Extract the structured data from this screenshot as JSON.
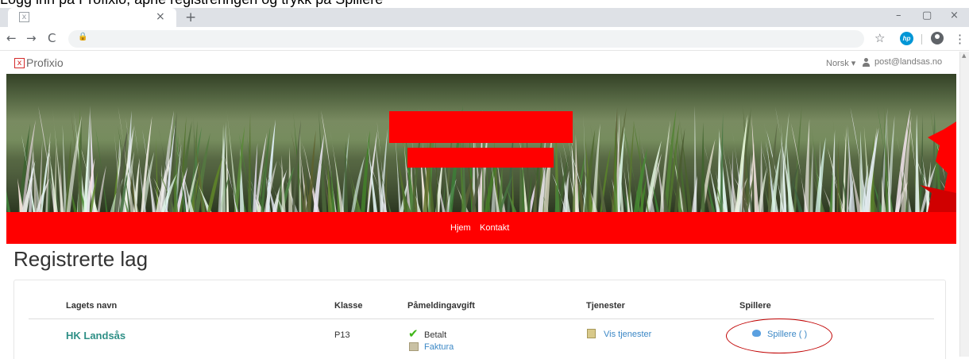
{
  "caption": "Logg inn på Profixio, åpne registreringen og trykk på Spillere",
  "browser": {
    "tab_close": "×",
    "new_tab": "+",
    "back": "←",
    "forward": "→",
    "reload": "C",
    "lock": "🔒",
    "url": "",
    "star": "☆",
    "hp": "hp",
    "kebab": "⋮",
    "minimize": "–",
    "maximize": "▢",
    "close": "×"
  },
  "site": {
    "logo_mark": "x",
    "logo_text": "Profixio",
    "language": "Norsk ▾",
    "user_email": "post@landsas.no"
  },
  "nav": {
    "home": "Hjem",
    "contact": "Kontakt"
  },
  "page_title": "Registrerte lag",
  "table": {
    "headers": {
      "team": "Lagets navn",
      "class": "Klasse",
      "fee": "Påmeldingavgift",
      "services": "Tjenester",
      "players": "Spillere"
    },
    "row": {
      "team": "HK Landsås",
      "class": "P13",
      "fee_status": "Betalt",
      "invoice": "Faktura",
      "services_link": "Vis tjenester",
      "players_link": "Spillere (   )"
    }
  },
  "colors": {
    "accent_red": "#ff0000",
    "team_teal": "#2e8f86",
    "link_blue": "#3c88c6",
    "paid_green": "#3fb618",
    "annotation_circle": "#c00000"
  }
}
